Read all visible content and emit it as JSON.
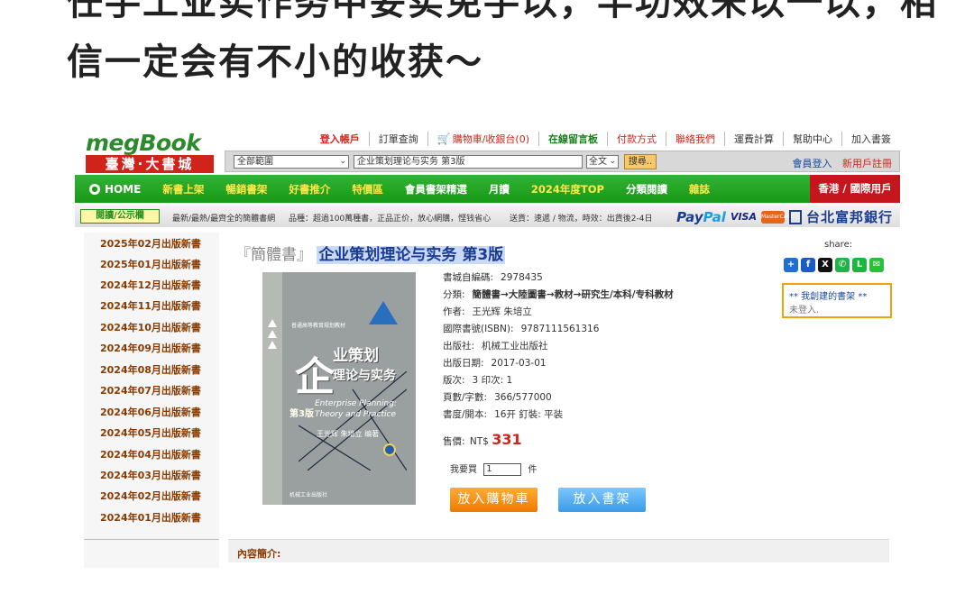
{
  "article": {
    "line1": "任手工业实作务中妥实免手以，半功效未以一以，相",
    "line2": "信一定会有不小的收获～"
  },
  "header": {
    "logo_top": "megBook",
    "logo_bottom": "臺灣·大書城",
    "toplinks": [
      {
        "label": "登入帳戶",
        "style": "red-bold"
      },
      {
        "label": "訂單查詢",
        "style": ""
      },
      {
        "label": "購物車/收銀台(0)",
        "style": "red",
        "icon": "cart-icon"
      },
      {
        "label": "在線留言板",
        "style": "green-bold"
      },
      {
        "label": "付款方式",
        "style": "red"
      },
      {
        "label": "聯絡我們",
        "style": "red"
      },
      {
        "label": "運費計算",
        "style": ""
      },
      {
        "label": "幫助中心",
        "style": ""
      },
      {
        "label": "加入書簽",
        "style": ""
      }
    ]
  },
  "search": {
    "scope": "全部範圍",
    "query": "企业策划理论与实务 第3版",
    "field": "全文",
    "button": "搜尋..",
    "member_login": "會員登入",
    "register": "新用戶註冊"
  },
  "nav": {
    "home": "HOME",
    "items": [
      {
        "label": "新書上架",
        "white": false
      },
      {
        "label": "暢銷書架",
        "white": false
      },
      {
        "label": "好書推介",
        "white": false
      },
      {
        "label": "特價區",
        "white": false
      },
      {
        "label": "會員書架精選",
        "white": true
      },
      {
        "label": "月讀",
        "white": true
      },
      {
        "label": "2024年度TOP",
        "white": false
      },
      {
        "label": "分類閱讀",
        "white": true
      },
      {
        "label": "雜誌",
        "white": false
      }
    ],
    "hk": "香港 / 國際用戶"
  },
  "infobar": {
    "tag": "閱讀/公示欄",
    "text1": "最新/最熱/最齊全的簡體書網",
    "text2": "品種：超過100萬種書，正品正价，放心網購，悭钱省心",
    "text3": "送貨：速遞 / 物流，時效：出貨後2-4日",
    "paypal_a": "Pay",
    "paypal_b": "Pal",
    "visa": "VISA",
    "mastercard": "MasterCard",
    "bank": "台北富邦銀行"
  },
  "sidebar": {
    "items": [
      "2025年02月出版新書",
      "2025年01月出版新書",
      "2024年12月出版新書",
      "2024年11月出版新書",
      "2024年10月出版新書",
      "2024年09月出版新書",
      "2024年08月出版新書",
      "2024年07月出版新書",
      "2024年06月出版新書",
      "2024年05月出版新書",
      "2024年04月出版新書",
      "2024年03月出版新書",
      "2024年02月出版新書",
      "2024年01月出版新書"
    ]
  },
  "product": {
    "prefix": "『簡體書』",
    "title": "企业策划理论与实务 第3版",
    "share_label": "share:",
    "share_icons": [
      "share-plus-icon",
      "facebook-icon",
      "x-icon",
      "whatsapp-icon",
      "line-icon",
      "wechat-icon"
    ],
    "shelf_title": "** 我創建的書架 **",
    "shelf_status": "未登入.",
    "cover": {
      "series": "普通高等教育规划教材",
      "big": "企",
      "mid1": "业策划",
      "mid2": "理论与实务",
      "en1": "Enterprise Planning:",
      "en2": "Theory and Practice",
      "edition": "第3版",
      "authors": "王光辉  朱培立  编著",
      "publisher": "机械工业出版社"
    },
    "details": [
      {
        "label": "書城自編碼:",
        "value": "2978435"
      },
      {
        "label": "分類:",
        "value": "簡體書→大陸圖書→教材→研究生/本科/专科教材"
      },
      {
        "label": "作者:",
        "value": "王光辉 朱培立"
      },
      {
        "label": "國際書號(ISBN):",
        "value": "9787111561316"
      },
      {
        "label": "出版社:",
        "value": "机械工业出版社"
      },
      {
        "label": "出版日期:",
        "value": "2017-03-01"
      },
      {
        "label": "版次:",
        "value": "3 印次:  1"
      },
      {
        "label": "頁數/字數:",
        "value": "366/577000"
      },
      {
        "label": "書度/開本:",
        "value": "16开 釘裝:  平装"
      }
    ],
    "price_label": "售價:",
    "price_currency": "NT$",
    "price_value": "331",
    "qty_label": "我要買",
    "qty_value": "1",
    "qty_unit": "件",
    "add_cart": "放入購物車",
    "add_shelf": "放入書架",
    "intro_label": "內容簡介:"
  },
  "colors": {
    "brand_green": "#179a17",
    "brand_red": "#d0241b",
    "nav_text": "#ffe94a",
    "sidebar_text": "#8a3a00",
    "title_highlight": "#c9daf8"
  }
}
